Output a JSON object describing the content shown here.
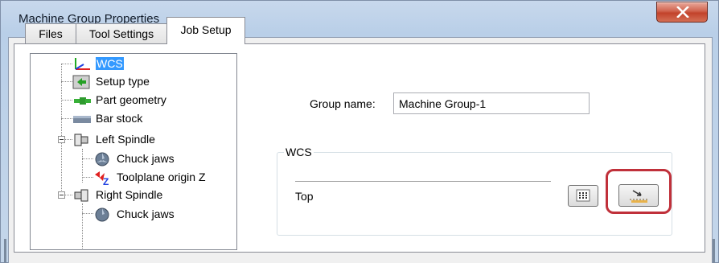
{
  "window": {
    "title": "Machine Group Properties",
    "close_icon": "close-x-icon"
  },
  "tabs": [
    {
      "label": "Files",
      "active": false
    },
    {
      "label": "Tool Settings",
      "active": false
    },
    {
      "label": "Job Setup",
      "active": true
    }
  ],
  "tree": {
    "items": [
      {
        "label": "WCS",
        "icon": "wcs-axes-icon",
        "selected": true
      },
      {
        "label": "Setup type",
        "icon": "setup-type-icon"
      },
      {
        "label": "Part geometry",
        "icon": "part-geometry-icon"
      },
      {
        "label": "Bar stock",
        "icon": "bar-stock-icon"
      },
      {
        "label": "Left Spindle",
        "icon": "left-spindle-icon",
        "expanded": true
      },
      {
        "label": "Chuck jaws",
        "icon": "chuck-jaws-icon"
      },
      {
        "label": "Toolplane origin Z",
        "icon": "toolplane-origin-icon"
      },
      {
        "label": "Right Spindle",
        "icon": "right-spindle-icon",
        "expanded": true
      },
      {
        "label": "Chuck jaws",
        "icon": "chuck-jaws-icon"
      }
    ]
  },
  "group": {
    "label": "Group name:",
    "value": "Machine Group-1"
  },
  "wcs": {
    "legend": "WCS",
    "value": "Top",
    "buttons": [
      {
        "name": "plane-list-button",
        "icon": "list-grid-icon"
      },
      {
        "name": "select-plane-button",
        "icon": "select-plane-icon",
        "highlighted": true
      }
    ]
  },
  "colors": {
    "highlight": "#c0303a",
    "selection": "#3399ff",
    "close": "#c2432b"
  }
}
